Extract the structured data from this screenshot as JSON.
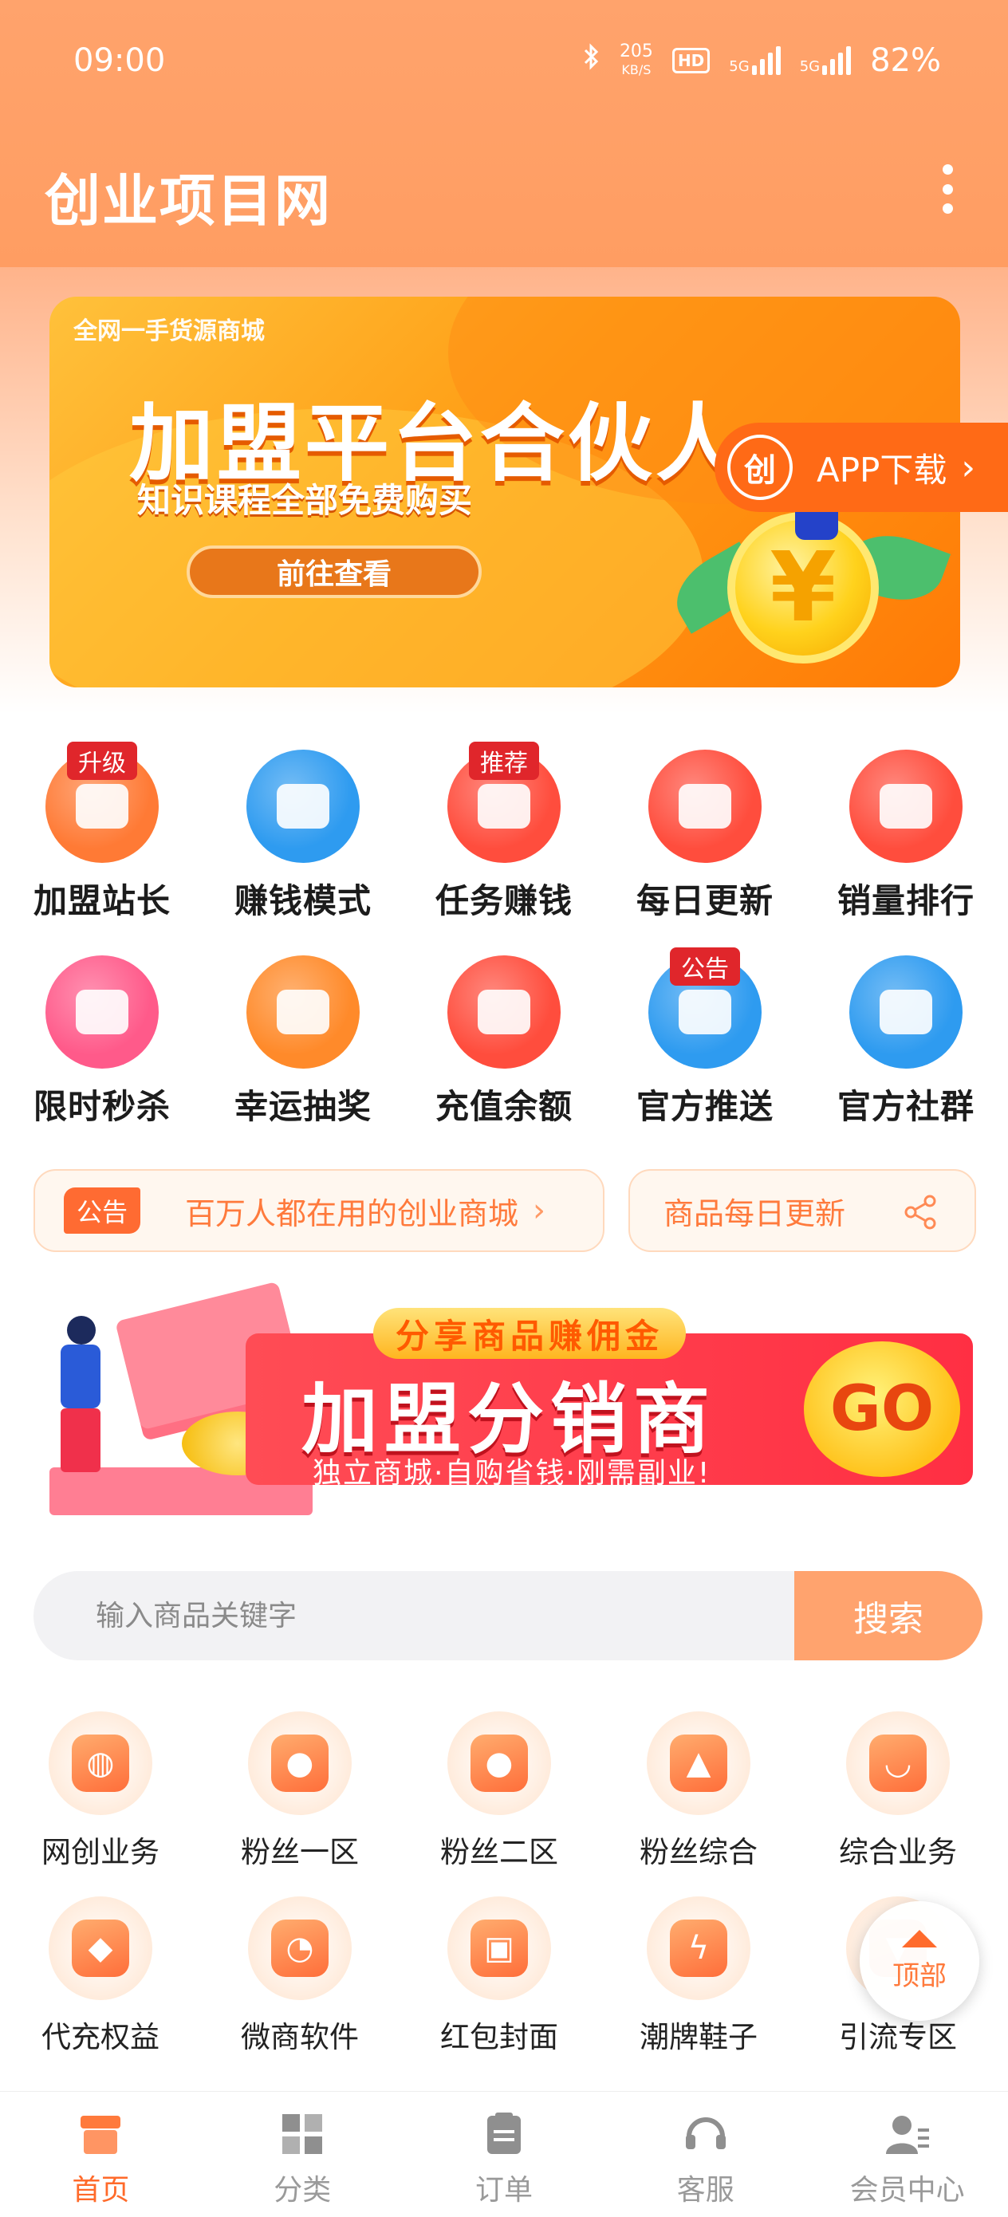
{
  "status_bar": {
    "time": "09:00",
    "net_speed_value": "205",
    "net_speed_unit": "KB/S",
    "hd_label": "HD",
    "signal1_label": "5G",
    "signal2_label": "5G",
    "battery": "82%"
  },
  "header": {
    "title": "创业项目网"
  },
  "banner": {
    "small_text": "全网一手货源商城",
    "title": "加盟平台合伙人",
    "subtitle": "知识课程全部免费购买",
    "button": "前往查看",
    "coin_symbol": "¥"
  },
  "app_download": {
    "icon_text": "创",
    "label": "APP下载"
  },
  "grid_row1": [
    {
      "label": "加盟站长",
      "badge": "升级",
      "icon": "store-icon",
      "color": "#ff7a35"
    },
    {
      "label": "赚钱模式",
      "badge": "",
      "icon": "book-icon",
      "color": "#2e9bf0"
    },
    {
      "label": "任务赚钱",
      "badge": "推荐",
      "icon": "alarm-coin-icon",
      "color": "#ff4d3d"
    },
    {
      "label": "每日更新",
      "badge": "",
      "icon": "shopping-bag-icon",
      "color": "#ff4d3d"
    },
    {
      "label": "销量排行",
      "badge": "",
      "icon": "cart-icon",
      "color": "#ff4d3d"
    }
  ],
  "grid_row2": [
    {
      "label": "限时秒杀",
      "badge": "",
      "icon": "alarm-clock-icon",
      "color": "#ff5a8a"
    },
    {
      "label": "幸运抽奖",
      "badge": "",
      "icon": "ticket-icon",
      "color": "#ff8a2a"
    },
    {
      "label": "充值余额",
      "badge": "",
      "icon": "wallet-icon",
      "color": "#ff4d3d"
    },
    {
      "label": "官方推送",
      "badge": "公告",
      "icon": "megaphone-icon",
      "color": "#2e9bf0"
    },
    {
      "label": "官方社群",
      "badge": "",
      "icon": "community-icon",
      "color": "#2e9bf0"
    }
  ],
  "notice": {
    "tag": "公告",
    "text": "百万人都在用的创业商城"
  },
  "daily_update": {
    "text": "商品每日更新"
  },
  "promo": {
    "top_label": "分享商品赚佣金",
    "title": "加盟分销商",
    "subtitle": "独立商城·自购省钱·刚需副业!",
    "go": "GO"
  },
  "search": {
    "placeholder": "输入商品关键字",
    "button": "搜索"
  },
  "categories_row1": [
    {
      "label": "网创业务",
      "icon": "globe-icon",
      "glyph": "◍"
    },
    {
      "label": "粉丝一区",
      "icon": "user-icon",
      "glyph": "●"
    },
    {
      "label": "粉丝二区",
      "icon": "user-icon",
      "glyph": "●"
    },
    {
      "label": "粉丝综合",
      "icon": "thumbs-up-icon",
      "glyph": "▲"
    },
    {
      "label": "综合业务",
      "icon": "bag-icon",
      "glyph": "◡"
    }
  ],
  "categories_row2": [
    {
      "label": "代充权益",
      "icon": "diamond-icon",
      "glyph": "◆"
    },
    {
      "label": "微商软件",
      "icon": "chat-icon",
      "glyph": "◔"
    },
    {
      "label": "红包封面",
      "icon": "red-envelope-icon",
      "glyph": "▣"
    },
    {
      "label": "潮牌鞋子",
      "icon": "lightning-clock-icon",
      "glyph": "ϟ"
    },
    {
      "label": "引流专区",
      "icon": "funnel-icon",
      "glyph": "▼"
    }
  ],
  "back_to_top": {
    "label": "顶部"
  },
  "tabbar": [
    {
      "label": "首页",
      "icon": "home-store-icon",
      "active": true
    },
    {
      "label": "分类",
      "icon": "grid-icon",
      "active": false
    },
    {
      "label": "订单",
      "icon": "clipboard-icon",
      "active": false
    },
    {
      "label": "客服",
      "icon": "headset-icon",
      "active": false
    },
    {
      "label": "会员中心",
      "icon": "member-icon",
      "active": false
    }
  ]
}
